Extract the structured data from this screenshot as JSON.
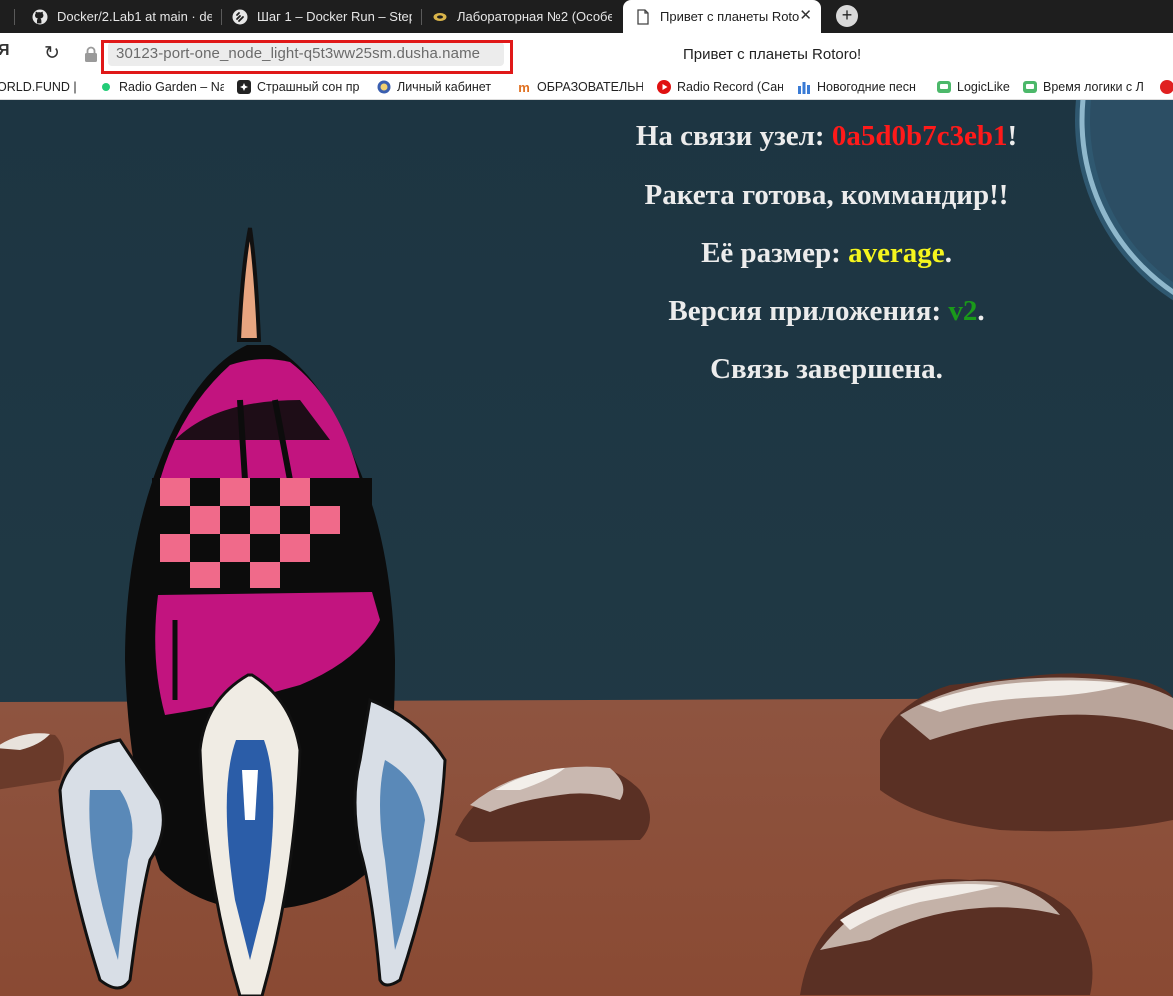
{
  "tabs": [
    {
      "label": "Docker/2.Lab1 at main · de",
      "icon": "github-icon"
    },
    {
      "label": "Шаг 1 – Docker Run – Step",
      "icon": "stepik-icon"
    },
    {
      "label": "Лабораторная №2 (Особе",
      "icon": "lms-icon"
    },
    {
      "label": "Привет с планеты Roto",
      "icon": "page-icon",
      "active": true
    }
  ],
  "address": {
    "url": "30123-port-one_node_light-q5t3ww25sm.dusha.name",
    "page_title": "Привет с планеты Rotoro!"
  },
  "bookmarks": [
    {
      "label": "ORLD.FUND |"
    },
    {
      "label": "Radio Garden – Na",
      "icon": "dot-icon"
    },
    {
      "label": "Страшный сон пр",
      "icon": "bookmark-icon"
    },
    {
      "label": "Личный кабинет",
      "icon": "emblem-icon"
    },
    {
      "label": "ОБРАЗОВАТЕЛЬН",
      "icon": "m-icon"
    },
    {
      "label": "Radio Record (Сан",
      "icon": "play-icon"
    },
    {
      "label": "Новогодние песн",
      "icon": "bars-icon"
    },
    {
      "label": "LogicLike",
      "icon": "logic-icon"
    },
    {
      "label": "Время логики с Л",
      "icon": "logic-icon"
    }
  ],
  "page": {
    "line1_prefix": "На связи узел: ",
    "node_id": "0a5d0b7c3eb1",
    "line1_suffix": "!",
    "line2": "Ракета готова, коммандир!!",
    "line3_prefix": "Её размер: ",
    "size": "average",
    "line3_suffix": ".",
    "line4_prefix": "Версия приложения: ",
    "version": "v2",
    "line4_suffix": ".",
    "line5": "Связь завершена."
  },
  "colors": {
    "sky": "#1e3540",
    "ground": "#8a4a35",
    "node_id": "#ff1a1a",
    "size": "#f5f51e",
    "version": "#1a9a1a",
    "url_highlight": "#e01818"
  }
}
